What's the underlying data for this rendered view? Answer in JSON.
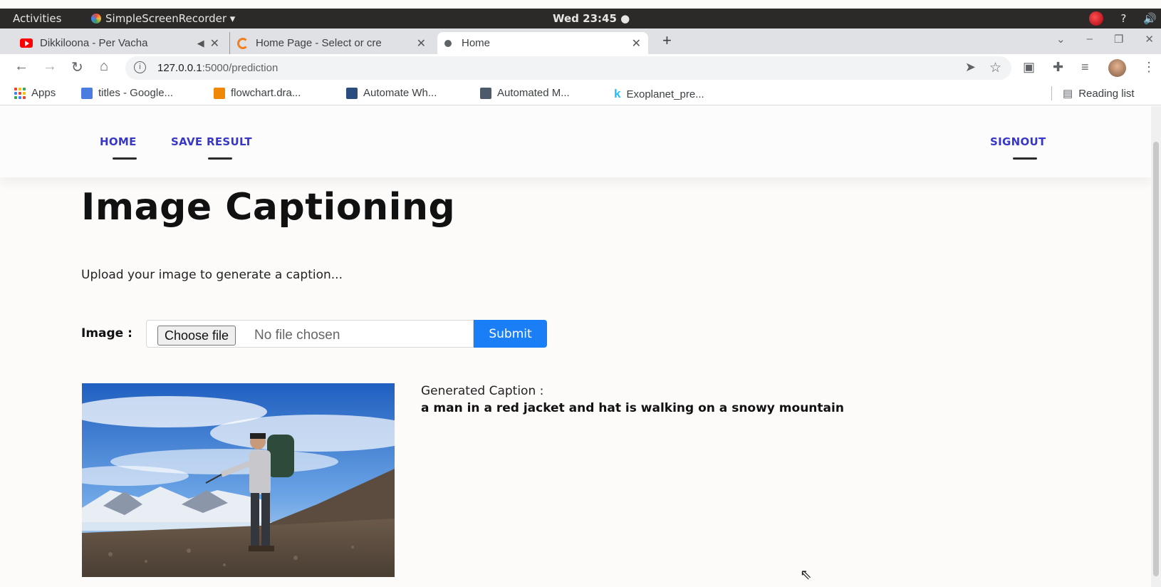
{
  "system_bar": {
    "activities": "Activities",
    "app_name": "SimpleScreenRecorder ▾",
    "clock": "Wed 23:45 ●",
    "tray_network": "?",
    "tray_volume": "🔊"
  },
  "tabs": [
    {
      "title": "Dikkiloona - Per Vacha",
      "icon": "youtube-icon",
      "muted": "◀"
    },
    {
      "title": "Home Page - Select or cre",
      "icon": "cloudflare-icon"
    },
    {
      "title": "Home",
      "icon": "globe-icon",
      "active": true
    }
  ],
  "toolbar": {
    "url_host": "127.0.0.1",
    "url_path": ":5000/prediction"
  },
  "bookmarks": [
    {
      "label": "Apps",
      "icon": "apps-grid-icon"
    },
    {
      "label": "titles - Google...",
      "icon": "google-docs-icon",
      "color": "#4a7ddf"
    },
    {
      "label": "flowchart.dra...",
      "icon": "drawio-icon",
      "color": "#f08705"
    },
    {
      "label": "Automate Wh...",
      "icon": "site-icon",
      "color": "#2b4c7e"
    },
    {
      "label": "Automated M...",
      "icon": "site-icon",
      "color": "#4d5a6a"
    },
    {
      "label": "Exoplanet_pre...",
      "icon": "kaggle-icon",
      "color": "#20beff"
    }
  ],
  "reading_list": "Reading list",
  "nav": {
    "home": "HOME",
    "save_result": "SAVE RESULT",
    "signout": "SIGNOUT"
  },
  "page": {
    "title": "Image Captioning",
    "subtitle": "Upload your image to generate a caption...",
    "image_label": "Image :",
    "choose_file": "Choose file",
    "file_status": "No file chosen",
    "submit": "Submit",
    "caption_label": "Generated Caption :",
    "caption_text": "a man in a red jacket and hat is walking on a snowy mountain"
  },
  "colors": {
    "nav_link": "#3737c8",
    "submit_bg": "#1a7ff6"
  }
}
